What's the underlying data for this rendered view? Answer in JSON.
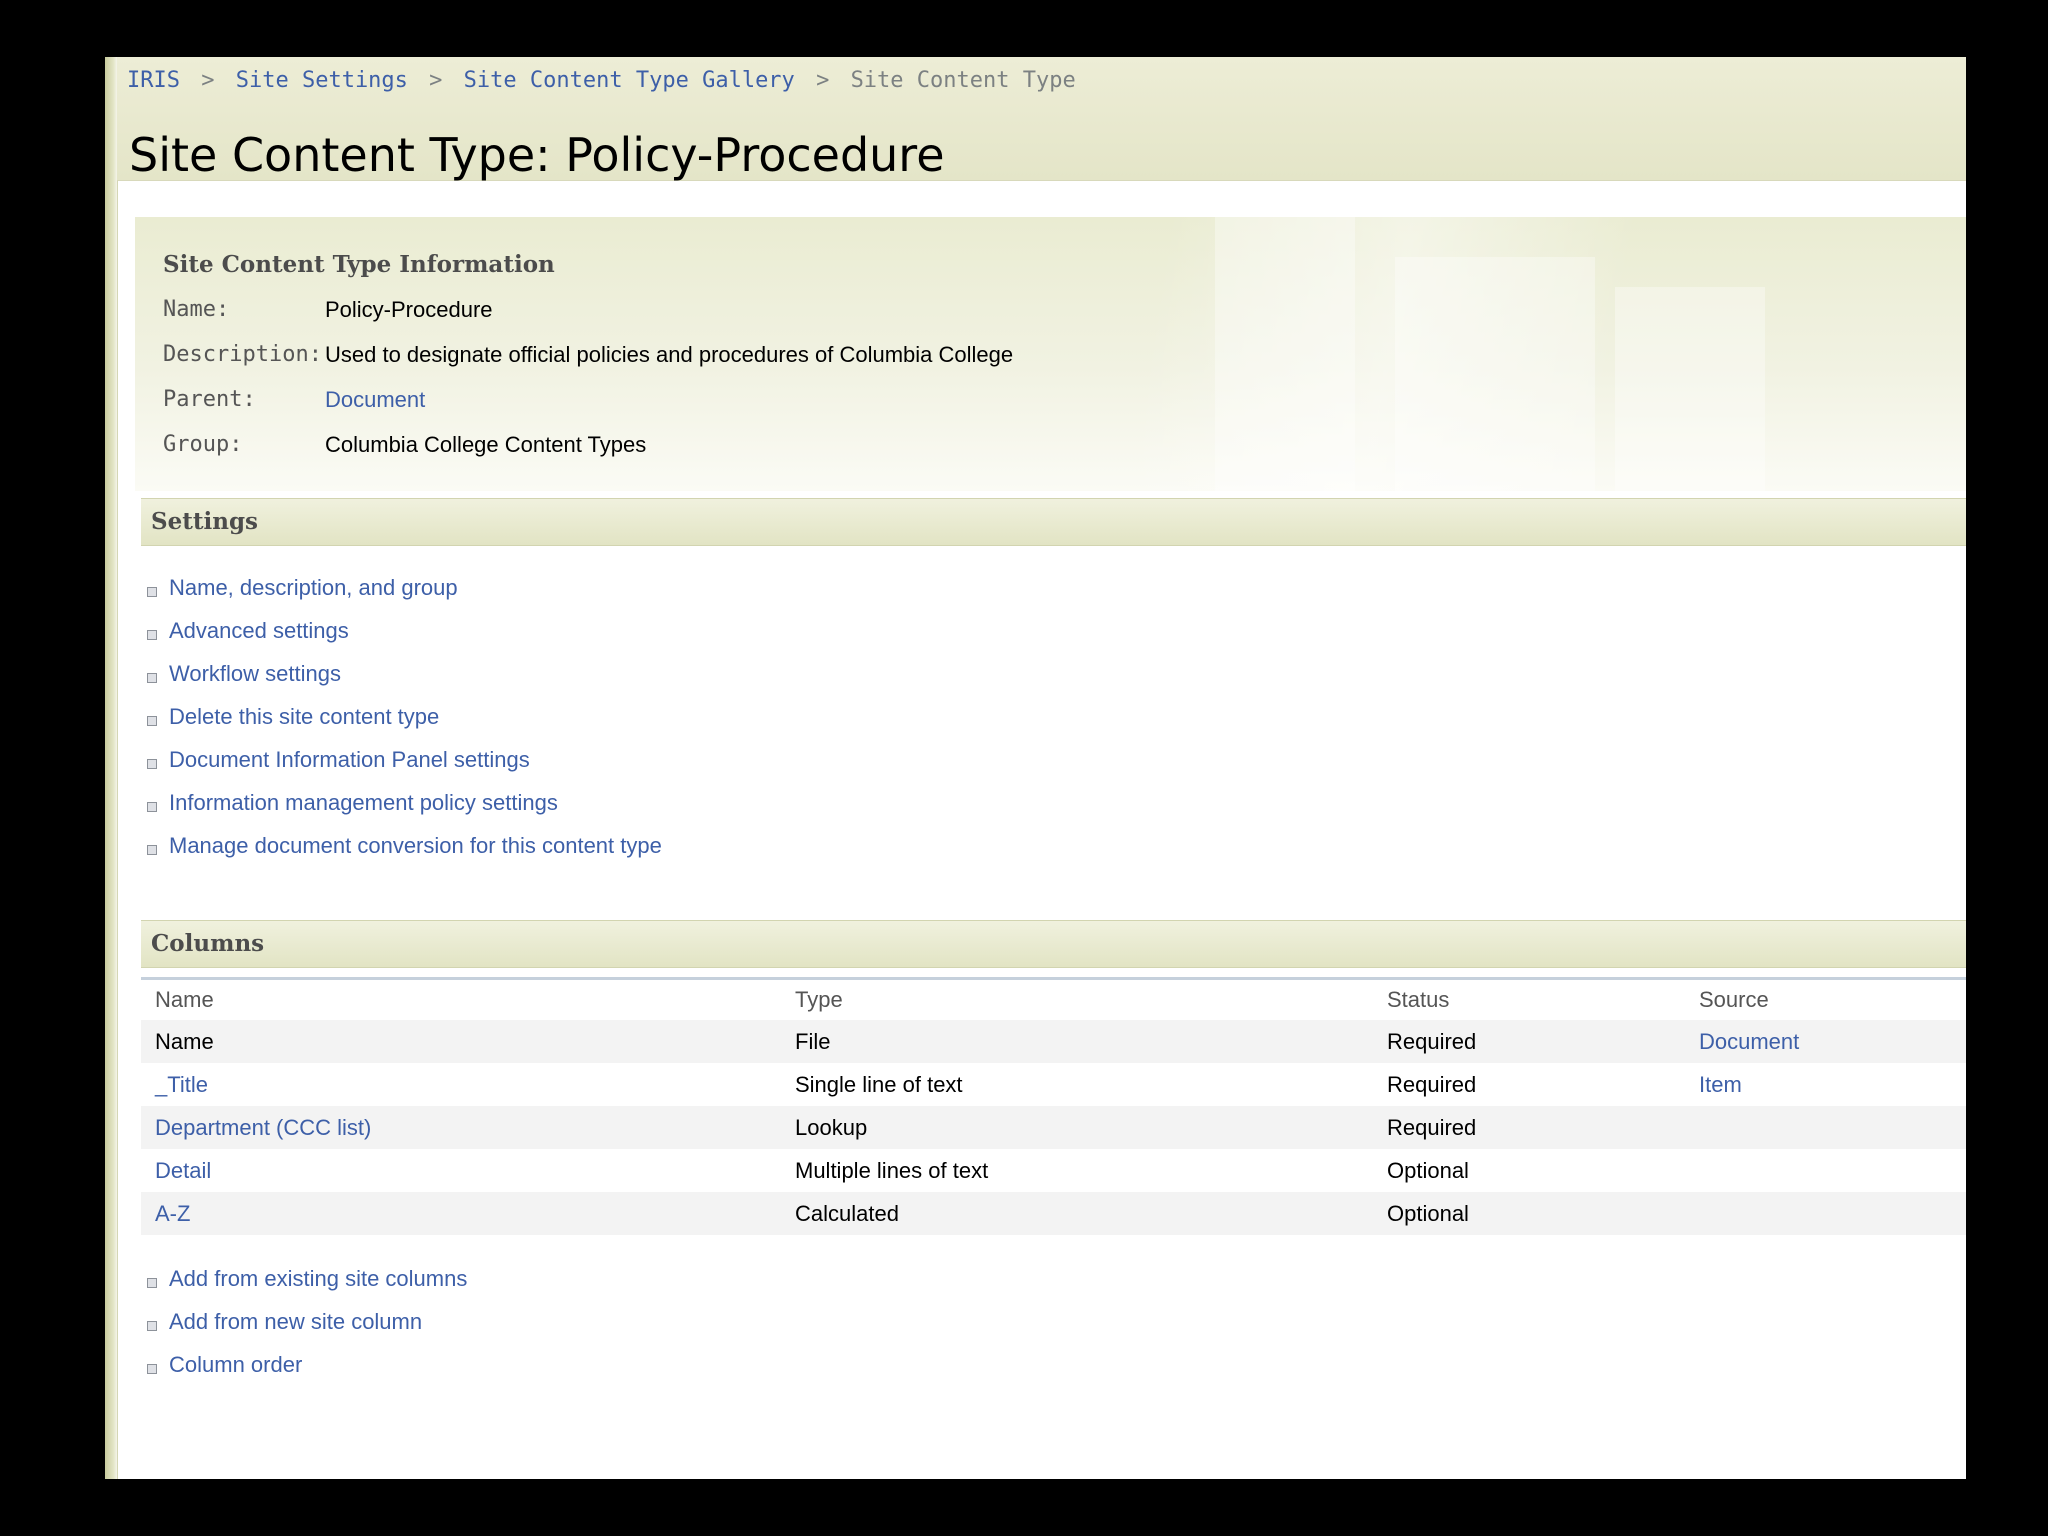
{
  "breadcrumb": {
    "items": [
      "IRIS",
      "Site Settings",
      "Site Content Type Gallery"
    ],
    "current": "Site Content Type",
    "separator": ">"
  },
  "page_title": "Site Content Type: Policy-Procedure",
  "info": {
    "title": "Site Content Type Information",
    "name_label": "Name:",
    "name_value": "Policy-Procedure",
    "description_label": "Description:",
    "description_value": "Used to designate official policies and procedures of Columbia College",
    "parent_label": "Parent:",
    "parent_value": "Document",
    "group_label": "Group:",
    "group_value": "Columbia College Content Types"
  },
  "settings": {
    "header": "Settings",
    "links": [
      "Name, description, and group",
      "Advanced settings",
      "Workflow settings",
      "Delete this site content type",
      "Document Information Panel settings",
      "Information management policy settings",
      "Manage document conversion for this content type"
    ]
  },
  "columns": {
    "header": "Columns",
    "table_headers": [
      "Name",
      "Type",
      "Status",
      "Source"
    ],
    "rows": [
      {
        "name": "Name",
        "type": "File",
        "status": "Required",
        "source": "Document"
      },
      {
        "name": "_Title",
        "type": "Single line of text",
        "status": "Required",
        "source": "Item"
      },
      {
        "name": "Department (CCC list)",
        "type": "Lookup",
        "status": "Required",
        "source": ""
      },
      {
        "name": "Detail",
        "type": "Multiple lines of text",
        "status": "Optional",
        "source": ""
      },
      {
        "name": "A-Z",
        "type": "Calculated",
        "status": "Optional",
        "source": ""
      }
    ],
    "links": [
      "Add from existing site columns",
      "Add from new site column",
      "Column order"
    ]
  },
  "colors": {
    "link": "#3d5fa8",
    "header_band": "#e4e5c8",
    "background": "#000000"
  },
  "icons": {
    "list_bullet": "square-bullet-icon"
  }
}
